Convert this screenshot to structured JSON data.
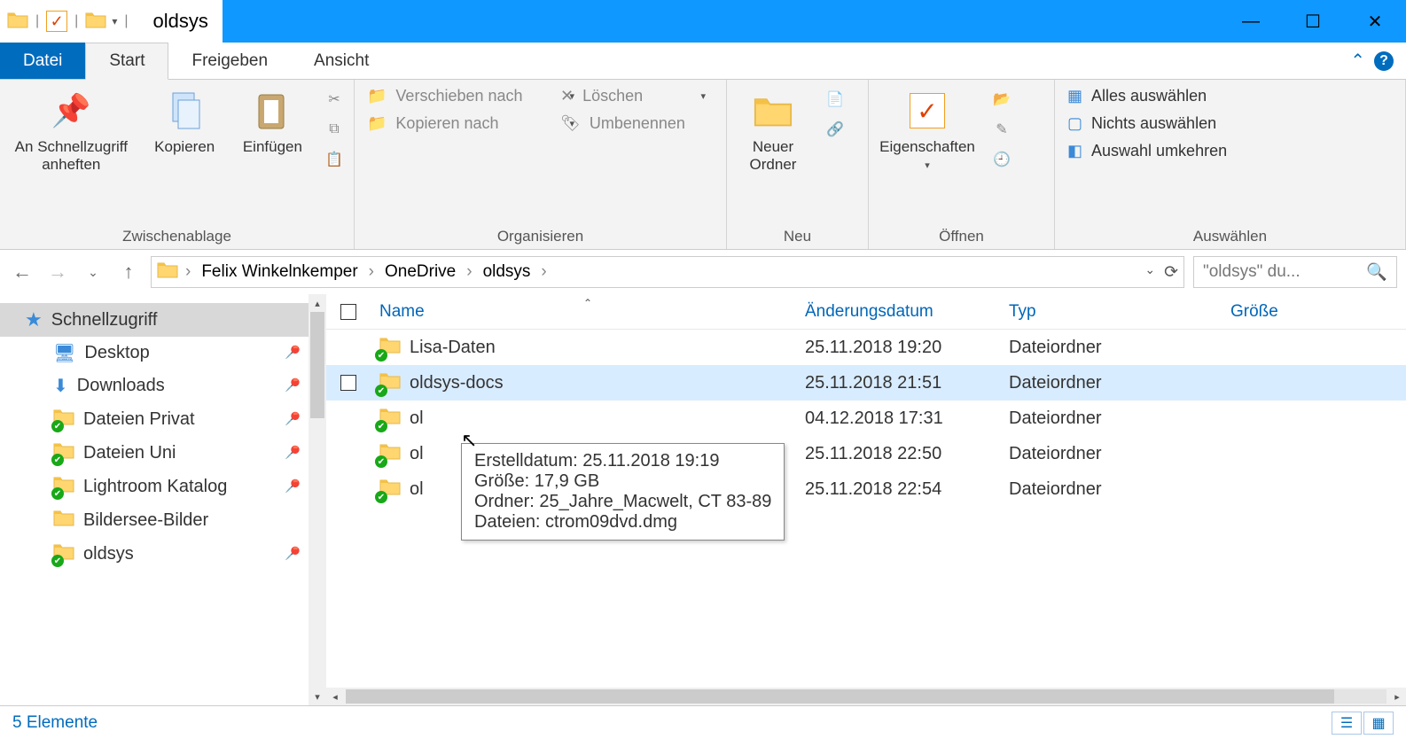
{
  "window": {
    "title": "oldsys"
  },
  "ribbon_tabs": {
    "file": "Datei",
    "start": "Start",
    "share": "Freigeben",
    "view": "Ansicht"
  },
  "ribbon": {
    "clipboard": {
      "label": "Zwischenablage",
      "pin": "An Schnellzugriff anheften",
      "copy": "Kopieren",
      "paste": "Einfügen"
    },
    "organize": {
      "label": "Organisieren",
      "move": "Verschieben nach",
      "copy_to": "Kopieren nach",
      "delete": "Löschen",
      "rename": "Umbenennen"
    },
    "new": {
      "label": "Neu",
      "folder": "Neuer Ordner"
    },
    "open": {
      "label": "Öffnen",
      "properties": "Eigenschaften"
    },
    "select": {
      "label": "Auswählen",
      "all": "Alles auswählen",
      "none": "Nichts auswählen",
      "invert": "Auswahl umkehren"
    }
  },
  "breadcrumbs": [
    "Felix Winkelnkemper",
    "OneDrive",
    "oldsys"
  ],
  "search_placeholder": "\"oldsys\" du...",
  "sidebar": {
    "quick_access": "Schnellzugriff",
    "items": [
      {
        "label": "Desktop",
        "pin": true,
        "sync": false,
        "icon": "desktop"
      },
      {
        "label": "Downloads",
        "pin": true,
        "sync": false,
        "icon": "download"
      },
      {
        "label": "Dateien Privat",
        "pin": true,
        "sync": true,
        "icon": "folder"
      },
      {
        "label": "Dateien Uni",
        "pin": true,
        "sync": true,
        "icon": "folder"
      },
      {
        "label": "Lightroom Katalog",
        "pin": true,
        "sync": true,
        "icon": "folder"
      },
      {
        "label": "Bildersee-Bilder",
        "pin": false,
        "sync": false,
        "icon": "folder"
      },
      {
        "label": "oldsys",
        "pin": true,
        "sync": true,
        "icon": "folder"
      }
    ]
  },
  "columns": {
    "name": "Name",
    "date": "Änderungsdatum",
    "type": "Typ",
    "size": "Größe"
  },
  "files": [
    {
      "name": "Lisa-Daten",
      "date": "25.11.2018 19:20",
      "type": "Dateiordner"
    },
    {
      "name": "oldsys-docs",
      "date": "25.11.2018 21:51",
      "type": "Dateiordner",
      "hover": true
    },
    {
      "name": "ol",
      "date": "04.12.2018 17:31",
      "type": "Dateiordner"
    },
    {
      "name": "ol",
      "date": "25.11.2018 22:50",
      "type": "Dateiordner"
    },
    {
      "name": "ol",
      "date": "25.11.2018 22:54",
      "type": "Dateiordner"
    }
  ],
  "tooltip": {
    "line1": "Erstelldatum: 25.11.2018 19:19",
    "line2": "Größe: 17,9 GB",
    "line3": "Ordner: 25_Jahre_Macwelt, CT 83-89",
    "line4": "Dateien: ctrom09dvd.dmg"
  },
  "status": {
    "count": "5 Elemente"
  }
}
